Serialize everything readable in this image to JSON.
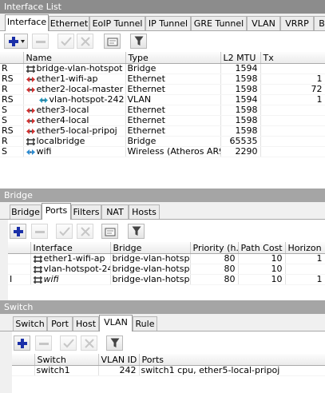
{
  "interface_list": {
    "title": "Interface List",
    "tabs": [
      "Interface",
      "Ethernet",
      "EoIP Tunnel",
      "IP Tunnel",
      "GRE Tunnel",
      "VLAN",
      "VRRP",
      "B"
    ],
    "columns": [
      "",
      "Name",
      "Type",
      "L2 MTU",
      "Tx"
    ],
    "rows": [
      {
        "flag": "R",
        "icon": "bridge-icon",
        "name": "bridge-vlan-hotspot",
        "type": "Bridge",
        "mtu": "1594",
        "tx": ""
      },
      {
        "flag": "RS",
        "icon": "ethernet-icon",
        "name": "ether1-wifi-ap",
        "type": "Ethernet",
        "mtu": "1598",
        "tx": "1"
      },
      {
        "flag": "R",
        "icon": "ethernet-icon",
        "name": "ether2-local-master",
        "type": "Ethernet",
        "mtu": "1598",
        "tx": "72"
      },
      {
        "flag": "RS",
        "icon": "vlan-icon",
        "name": "vlan-hotspot-242",
        "type": "VLAN",
        "mtu": "1594",
        "tx": "1"
      },
      {
        "flag": "S",
        "icon": "ethernet-icon",
        "name": "ether3-local",
        "type": "Ethernet",
        "mtu": "1598",
        "tx": ""
      },
      {
        "flag": "S",
        "icon": "ethernet-icon",
        "name": "ether4-local",
        "type": "Ethernet",
        "mtu": "1598",
        "tx": ""
      },
      {
        "flag": "RS",
        "icon": "ethernet-icon",
        "name": "ether5-local-pripoj",
        "type": "Ethernet",
        "mtu": "1598",
        "tx": ""
      },
      {
        "flag": "R",
        "icon": "bridge-icon",
        "name": "localbridge",
        "type": "Bridge",
        "mtu": "65535",
        "tx": ""
      },
      {
        "flag": "S",
        "icon": "wireless-icon",
        "name": "wifi",
        "type": "Wireless (Atheros AR9...",
        "mtu": "2290",
        "tx": ""
      }
    ]
  },
  "bridge": {
    "title": "Bridge",
    "tabs": [
      "Bridge",
      "Ports",
      "Filters",
      "NAT",
      "Hosts"
    ],
    "columns": [
      "",
      "Interface",
      "Bridge",
      "Priority (h...",
      "Path Cost",
      "Horizon"
    ],
    "rows": [
      {
        "flag": "",
        "icon": "bridge-port-icon",
        "iface": "ether1-wifi-ap",
        "bridge": "bridge-vlan-hotspot",
        "priority": "80",
        "cost": "10",
        "horizon": "1"
      },
      {
        "flag": "",
        "icon": "bridge-port-icon",
        "iface": "vlan-hotspot-242",
        "bridge": "bridge-vlan-hotspot",
        "priority": "80",
        "cost": "10",
        "horizon": ""
      },
      {
        "flag": "I",
        "icon": "bridge-port-icon",
        "iface": "wifi",
        "bridge": "bridge-vlan-hotspot",
        "priority": "80",
        "cost": "10",
        "horizon": "1"
      }
    ]
  },
  "switch": {
    "title": "Switch",
    "tabs": [
      "Switch",
      "Port",
      "Host",
      "VLAN",
      "Rule"
    ],
    "columns": [
      "",
      "Switch",
      "VLAN ID",
      "Ports"
    ],
    "rows": [
      {
        "flag": "",
        "switch": "switch1",
        "vlan_id": "242",
        "ports": "switch1 cpu, ether5-local-pripoj"
      }
    ]
  },
  "colors": {
    "add": "#1a2fa8",
    "remove": "#e04040",
    "vlan": "#2a9fc4",
    "wifi": "#2a8ad0"
  }
}
